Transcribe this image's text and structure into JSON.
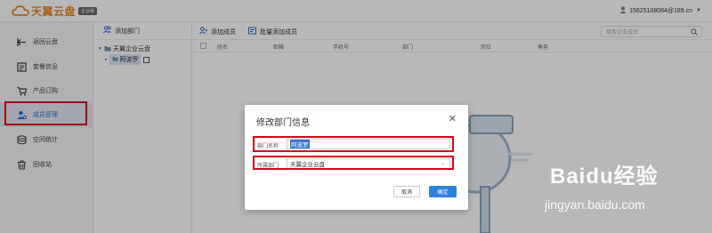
{
  "app": {
    "logo_text": "天翼云盘",
    "logo_badge": "企业版"
  },
  "user": {
    "account": "15625108084@189.cn"
  },
  "sidebar": {
    "items": [
      {
        "label": "返回云盘",
        "icon": "return-icon"
      },
      {
        "label": "套餐信息",
        "icon": "package-icon"
      },
      {
        "label": "产品订购",
        "icon": "cart-icon"
      },
      {
        "label": "成员管理",
        "icon": "member-icon"
      },
      {
        "label": "空间统计",
        "icon": "storage-icon"
      },
      {
        "label": "回收站",
        "icon": "trash-icon"
      }
    ]
  },
  "dept_panel": {
    "add_dept_label": "添加部门",
    "tree_root": "天翼企业云盘",
    "tree_child": "阿波罗"
  },
  "toolbar": {
    "add_member_label": "添加成员",
    "batch_add_label": "批量添加成员",
    "search_placeholder": "搜索企业成员"
  },
  "table": {
    "headers": [
      "姓名",
      "邮箱",
      "手机号",
      "部门",
      "岗位",
      "角色"
    ]
  },
  "modal": {
    "title": "修改部门信息",
    "name_label": "部门名称",
    "name_value": "阿波罗",
    "parent_label": "所属部门",
    "parent_value": "天翼企业云盘",
    "cancel_label": "取消",
    "ok_label": "确定"
  },
  "watermark": {
    "brand": "Baidu经验",
    "url": "jingyan.baidu.com"
  },
  "colors": {
    "accent": "#2f7fde",
    "highlight": "#d9001b",
    "logo": "#e8892b"
  }
}
